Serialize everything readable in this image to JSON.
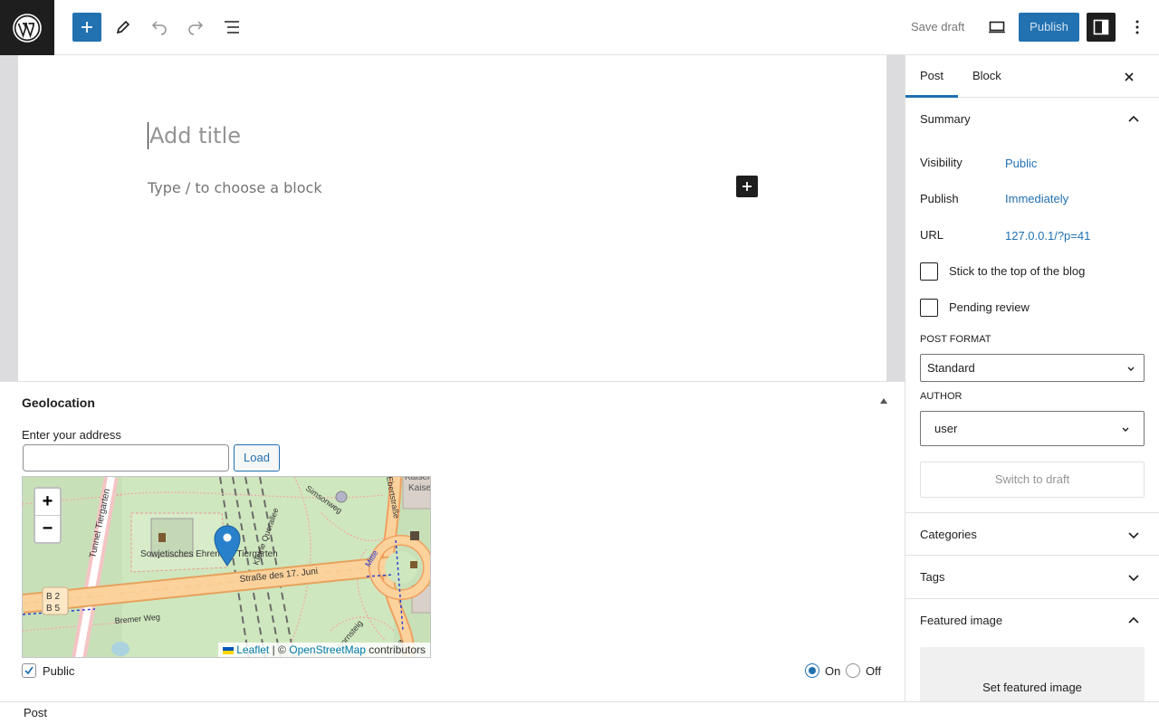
{
  "toolbar": {
    "logo_icon": "wordpress-logo-icon",
    "save_draft_label": "Save draft",
    "publish_label": "Publish",
    "accent_color": "#2271b1"
  },
  "editor": {
    "title_placeholder": "Add title",
    "block_placeholder": "Type / to choose a block"
  },
  "geolocation": {
    "heading": "Geolocation",
    "address_label": "Enter your address",
    "address_value": "",
    "load_label": "Load",
    "map": {
      "zoom_in": "+",
      "zoom_out": "−",
      "labels": {
        "memorial": "Sowjetisches Ehrenmal Tiergarten",
        "street_main": "Straße des 17. Juni",
        "tunnel": "Tunnel Tiergarten",
        "bremer": "Bremer Weg",
        "simson": "Simsonweg",
        "querallee": "Kleine Querallee",
        "ebert": "Ebertstraße",
        "haus": "Kaiser Haus",
        "b2": "B 2",
        "b5": "B 5",
        "mitte": "Mitte",
        "horn": "hornsteig",
        "age": "age"
      },
      "attribution": {
        "leaflet": "Leaflet",
        "separator": "| ©",
        "osm": "OpenStreetMap",
        "contributors": "contributors"
      }
    },
    "public_label": "Public",
    "public_checked": true,
    "on_label": "On",
    "off_label": "Off",
    "selected": "On"
  },
  "footer": {
    "breadcrumb": "Post"
  },
  "sidebar": {
    "tabs": [
      {
        "label": "Post",
        "active": true
      },
      {
        "label": "Block",
        "active": false
      }
    ],
    "summary": {
      "heading": "Summary",
      "visibility_label": "Visibility",
      "visibility_value": "Public",
      "publish_label": "Publish",
      "publish_value": "Immediately",
      "url_label": "URL",
      "url_value": "127.0.0.1/?p=41",
      "stick_label": "Stick to the top of the blog",
      "pending_label": "Pending review",
      "post_format_label": "POST FORMAT",
      "post_format_value": "Standard",
      "author_label": "AUTHOR",
      "author_value": "user",
      "switch_label": "Switch to draft"
    },
    "categories_heading": "Categories",
    "tags_heading": "Tags",
    "featured_heading": "Featured image",
    "featured_button": "Set featured image"
  }
}
